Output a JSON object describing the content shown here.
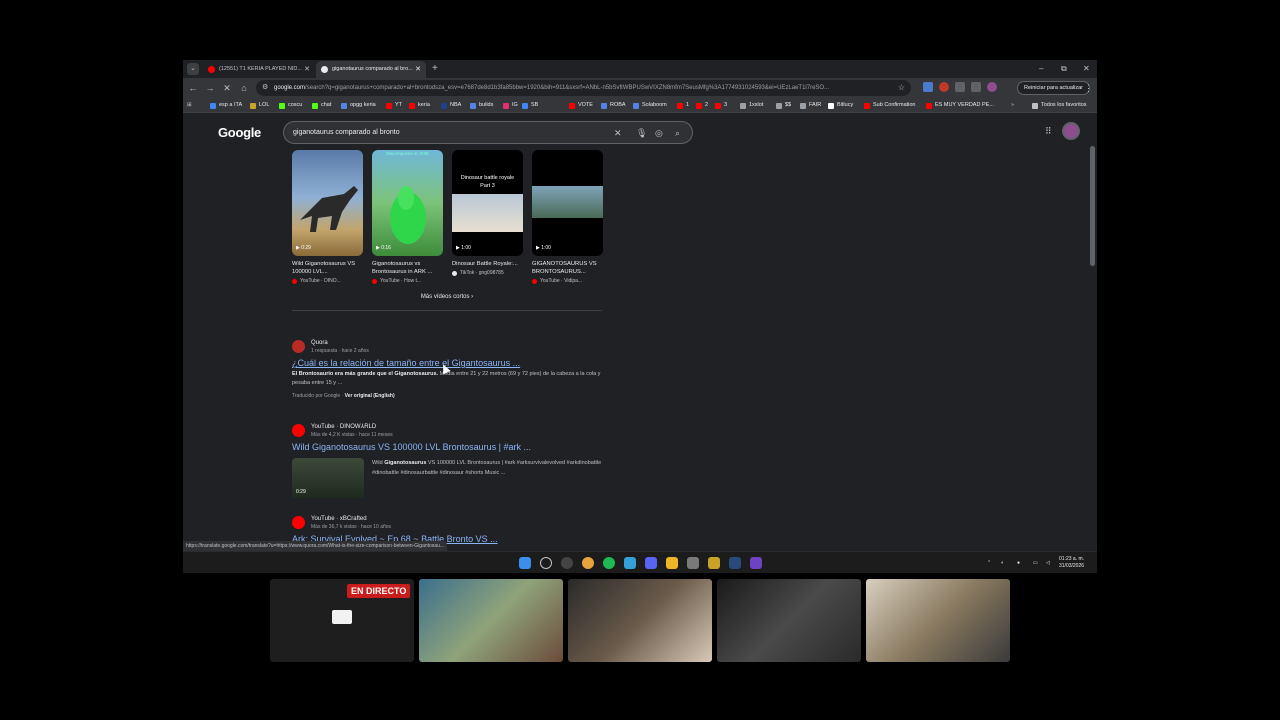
{
  "tabs": [
    {
      "title": "(12551) T1 KERIA PLAYED NID...",
      "active": false,
      "favicon_color": "#ff0000"
    },
    {
      "title": "giganotaurus comparado al bro...",
      "active": true,
      "favicon_color": "#e8eaed"
    }
  ],
  "window_controls": {
    "minimize": "–",
    "maximize": "⧉",
    "close": "✕"
  },
  "omnibox": {
    "host": "google.com",
    "path": "/search?q=giganotaurus+comparado+al+brontodsza_esv=e7687de8d1b3fa85bbw=1920&bih=911&sxsrf=ANbL-n5bSvftWBPUSwVIXZN8mfm7SeusMfg%3A1774931024593&ei=UEzLaeT1l7reSO..."
  },
  "update_button": "Reiniciar para actualizar",
  "bookmarks": [
    {
      "label": "esp a ITA",
      "color": "#4285f4"
    },
    {
      "label": "LOL",
      "color": "#c9a227"
    },
    {
      "label": "coscu",
      "color": "#53fc18"
    },
    {
      "label": "chat",
      "color": "#53fc18"
    },
    {
      "label": "opgg keria",
      "color": "#5383e8"
    },
    {
      "label": "YT",
      "color": "#ff0000"
    },
    {
      "label": "keria",
      "color": "#ff0000"
    },
    {
      "label": "NBA",
      "color": "#1d428a"
    },
    {
      "label": "builds",
      "color": "#5383e8"
    },
    {
      "label": "IG",
      "color": "#e1306c"
    },
    {
      "label": "SB",
      "color": "#4285f4"
    },
    {
      "label": "VOTE",
      "color": "#ff0000"
    },
    {
      "label": "ROBA",
      "color": "#5383e8"
    },
    {
      "label": "Solaboom",
      "color": "#5383e8"
    },
    {
      "label": "1",
      "color": "#ff0000"
    },
    {
      "label": "2",
      "color": "#ff0000"
    },
    {
      "label": "3",
      "color": "#ff0000"
    },
    {
      "label": "1xslot",
      "color": "#9aa0a6"
    },
    {
      "label": "$$",
      "color": "#9aa0a6"
    },
    {
      "label": "FAIR",
      "color": "#9aa0a6"
    },
    {
      "label": "Bitlucy",
      "color": "#ffffff"
    },
    {
      "label": "Sub Confirmation",
      "color": "#ff0000"
    },
    {
      "label": "ES MUY VERDAD PE...",
      "color": "#ff0000"
    }
  ],
  "all_bookmarks": "Todos los favoritos",
  "google": {
    "logo": "Google",
    "query": "giganotaurus comparado al bronto"
  },
  "shorts": [
    {
      "title": "Wild Giganotosaurus VS 100000 LVL...",
      "duration": "▶ 0:29",
      "source": "YouTube · DINO...",
      "src_color": "#ff0000"
    },
    {
      "title": "Giganotosaurus vs Brontosaurus in ARK ...",
      "duration": "▶ 0:16",
      "source": "YouTube · How t...",
      "src_color": "#ff0000",
      "overlay": "Decomposes in: 0:05"
    },
    {
      "title": "Dinosaur Battle Royale:...",
      "duration": "▶ 1:00",
      "source": "TikTok · gng098785",
      "src_color": "#e8eaed",
      "overlay": "Dinosaur battle royale Part 3"
    },
    {
      "title": "GIGANOTOSAURUS VS BRONTOSAURUS...",
      "duration": "▶ 1:00",
      "source": "YouTube · Vidipa...",
      "src_color": "#ff0000"
    }
  ],
  "more_shorts": "Más vídeos cortos  ›",
  "results": [
    {
      "source": "Quora",
      "meta": "1 respuesta · hace 2 años",
      "title": "¿Cuál es la relación de tamaño entre el Gigantosaurus ...",
      "snippet_bold": "El Brontosaurio era más grande que el Giganotosaurus.",
      "snippet": " Media entre 21 y 22 metros (69 y 72 pies) de la cabeza a la cola y pesaba entre 15 y ...",
      "translated": "Traducido por Google ·",
      "original": "Ver original (English)"
    },
    {
      "source": "YouTube · DINOW⅄RLD",
      "meta": "Más de 4,2 K vistas · hace 11 meses",
      "title": "Wild Giganotosaurus VS 100000 LVL Brontosaurus | #ark ...",
      "video_text_pre": "Wild ",
      "video_text_bold": "Giganotosaurus",
      "video_text": " VS 100000 LVL Brontosaurus | #ark #arksurvivalevolved #arkdinobattle #dinobattle #dinosaurbattle #dinosaur #shorts Music ...",
      "duration": "0:29"
    },
    {
      "source": "YouTube · xBCrafted",
      "meta": "Más de 36,7 k vistas · hace 10 años",
      "title": "Ark: Survival Evolved ~ Ep.68 ~ Battle Bronto VS ..."
    }
  ],
  "status_url": "https://translate.google.com/translate?u=https://www.quora.com/What-is-the-size-comparison-between-Gigantosau...",
  "clock": {
    "time": "01:23 a. m.",
    "date": "31/03/2026"
  },
  "live_badge": "EN DIRECTO"
}
